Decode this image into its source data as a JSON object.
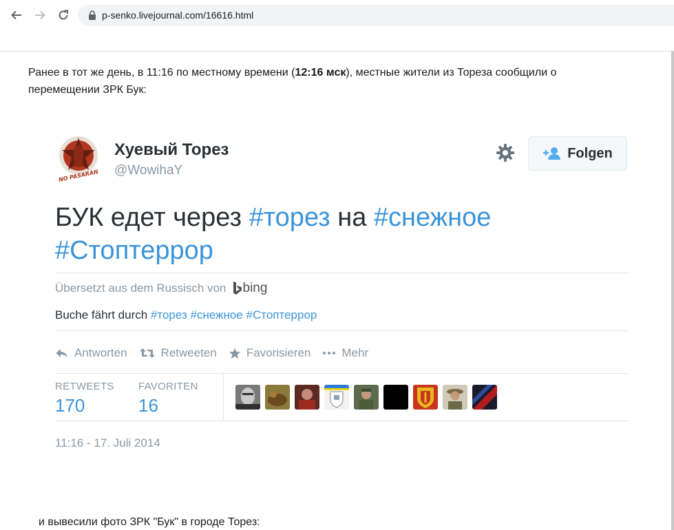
{
  "browser": {
    "url": "p-senko.livejournal.com/16616.html",
    "back_icon": "arrow-left-icon",
    "forward_icon": "arrow-right-icon",
    "reload_icon": "reload-icon",
    "lock_icon": "lock-icon"
  },
  "article": {
    "intro_part1": "Ранее в тот же день, в 11:16 по местному времени (",
    "intro_bold": "12:16 мск",
    "intro_part2": "), местные жители из Тореза сообщили о перемещении ЗРК Бук:",
    "footer": "и вывесили фото ЗРК \"Бук\" в городе Торез:"
  },
  "tweet": {
    "avatar_text": "NO PASARAN",
    "display_name": "Хуевый Торез",
    "handle": "@WowihaY",
    "follow_label": "Folgen",
    "text": {
      "plain1": "БУК едет через ",
      "tag1": "#торез",
      "plain2": " на ",
      "tag2": "#снежное",
      "tag3": "#Стоптеррор"
    },
    "translated_by": "Übersetzt aus dem Russisch von",
    "translator": "bing",
    "translation": {
      "plain": "Buche fährt durch ",
      "tag1": "#торез",
      "tag2": "#снежное",
      "tag3": "#Стоптеррор"
    },
    "actions": {
      "reply": "Antworten",
      "retweet": "Retweeten",
      "favorite": "Favorisieren",
      "more": "Mehr"
    },
    "stats": {
      "retweets_label": "RETWEETS",
      "retweets_value": "170",
      "favorites_label": "FAVORITEN",
      "favorites_value": "16"
    },
    "timestamp": "11:16 - 17. Juli 2014"
  },
  "colors": {
    "link": "#3b94d9",
    "muted": "#8899a6",
    "text": "#292f33",
    "divider": "#e1e8ed"
  }
}
